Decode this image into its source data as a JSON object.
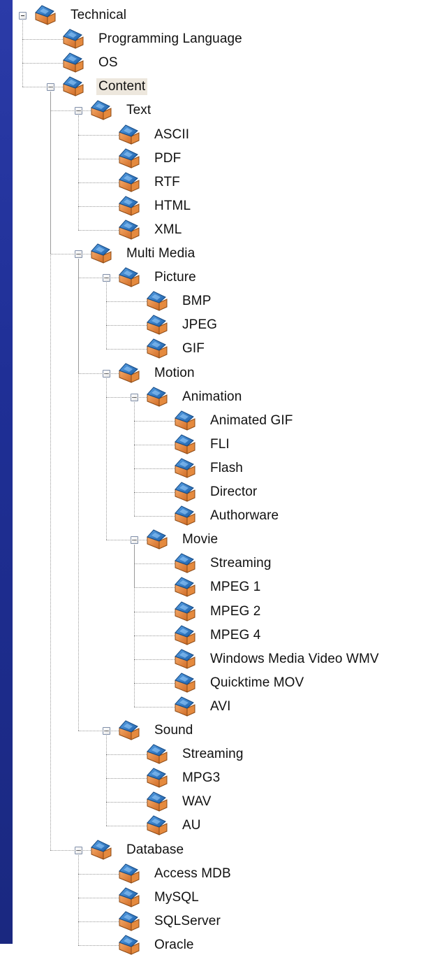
{
  "window": {
    "background": "#23245f",
    "panel_background": "#ffffff",
    "selected_background": "#ede7dd"
  },
  "tree": {
    "nodes": [
      {
        "label": "Technical",
        "expanded": true,
        "icon": "folder-arrow-icon"
      },
      {
        "label": "Programming Language",
        "expanded": false,
        "icon": "folder-arrow-icon"
      },
      {
        "label": "OS",
        "expanded": false,
        "icon": "folder-arrow-icon"
      },
      {
        "label": "Content",
        "expanded": true,
        "selected": true,
        "icon": "folder-arrow-icon"
      },
      {
        "label": "Text",
        "expanded": true,
        "icon": "folder-arrow-icon"
      },
      {
        "label": "ASCII",
        "icon": "folder-arrow-icon"
      },
      {
        "label": "PDF",
        "icon": "folder-arrow-icon"
      },
      {
        "label": "RTF",
        "icon": "folder-arrow-icon"
      },
      {
        "label": "HTML",
        "icon": "folder-arrow-icon"
      },
      {
        "label": "XML",
        "icon": "folder-arrow-icon"
      },
      {
        "label": "Multi Media",
        "expanded": true,
        "icon": "folder-arrow-icon"
      },
      {
        "label": "Picture",
        "expanded": true,
        "icon": "folder-arrow-icon"
      },
      {
        "label": "BMP",
        "icon": "folder-arrow-icon"
      },
      {
        "label": "JPEG",
        "icon": "folder-arrow-icon"
      },
      {
        "label": "GIF",
        "icon": "folder-arrow-icon"
      },
      {
        "label": "Motion",
        "expanded": true,
        "icon": "folder-arrow-icon"
      },
      {
        "label": "Animation",
        "expanded": true,
        "icon": "folder-arrow-icon"
      },
      {
        "label": "Animated GIF",
        "icon": "folder-arrow-icon"
      },
      {
        "label": "FLI",
        "icon": "folder-arrow-icon"
      },
      {
        "label": "Flash",
        "icon": "folder-arrow-icon"
      },
      {
        "label": "Director",
        "icon": "folder-arrow-icon"
      },
      {
        "label": "Authorware",
        "icon": "folder-arrow-icon"
      },
      {
        "label": "Movie",
        "expanded": true,
        "icon": "folder-arrow-icon"
      },
      {
        "label": "Streaming",
        "icon": "folder-arrow-icon"
      },
      {
        "label": "MPEG 1",
        "icon": "folder-arrow-icon"
      },
      {
        "label": "MPEG 2",
        "icon": "folder-arrow-icon"
      },
      {
        "label": "MPEG 4",
        "icon": "folder-arrow-icon"
      },
      {
        "label": "Windows Media Video WMV",
        "icon": "folder-arrow-icon"
      },
      {
        "label": "Quicktime MOV",
        "icon": "folder-arrow-icon"
      },
      {
        "label": "AVI",
        "icon": "folder-arrow-icon"
      },
      {
        "label": "Sound",
        "expanded": true,
        "icon": "folder-arrow-icon"
      },
      {
        "label": "Streaming",
        "icon": "folder-arrow-icon"
      },
      {
        "label": "MPG3",
        "icon": "folder-arrow-icon"
      },
      {
        "label": "WAV",
        "icon": "folder-arrow-icon"
      },
      {
        "label": "AU",
        "icon": "folder-arrow-icon"
      },
      {
        "label": "Database",
        "expanded": true,
        "icon": "folder-arrow-icon"
      },
      {
        "label": "Access MDB",
        "icon": "folder-arrow-icon"
      },
      {
        "label": "MySQL",
        "icon": "folder-arrow-icon"
      },
      {
        "label": "SQLServer",
        "icon": "folder-arrow-icon"
      },
      {
        "label": "Oracle",
        "icon": "folder-arrow-icon"
      }
    ]
  }
}
